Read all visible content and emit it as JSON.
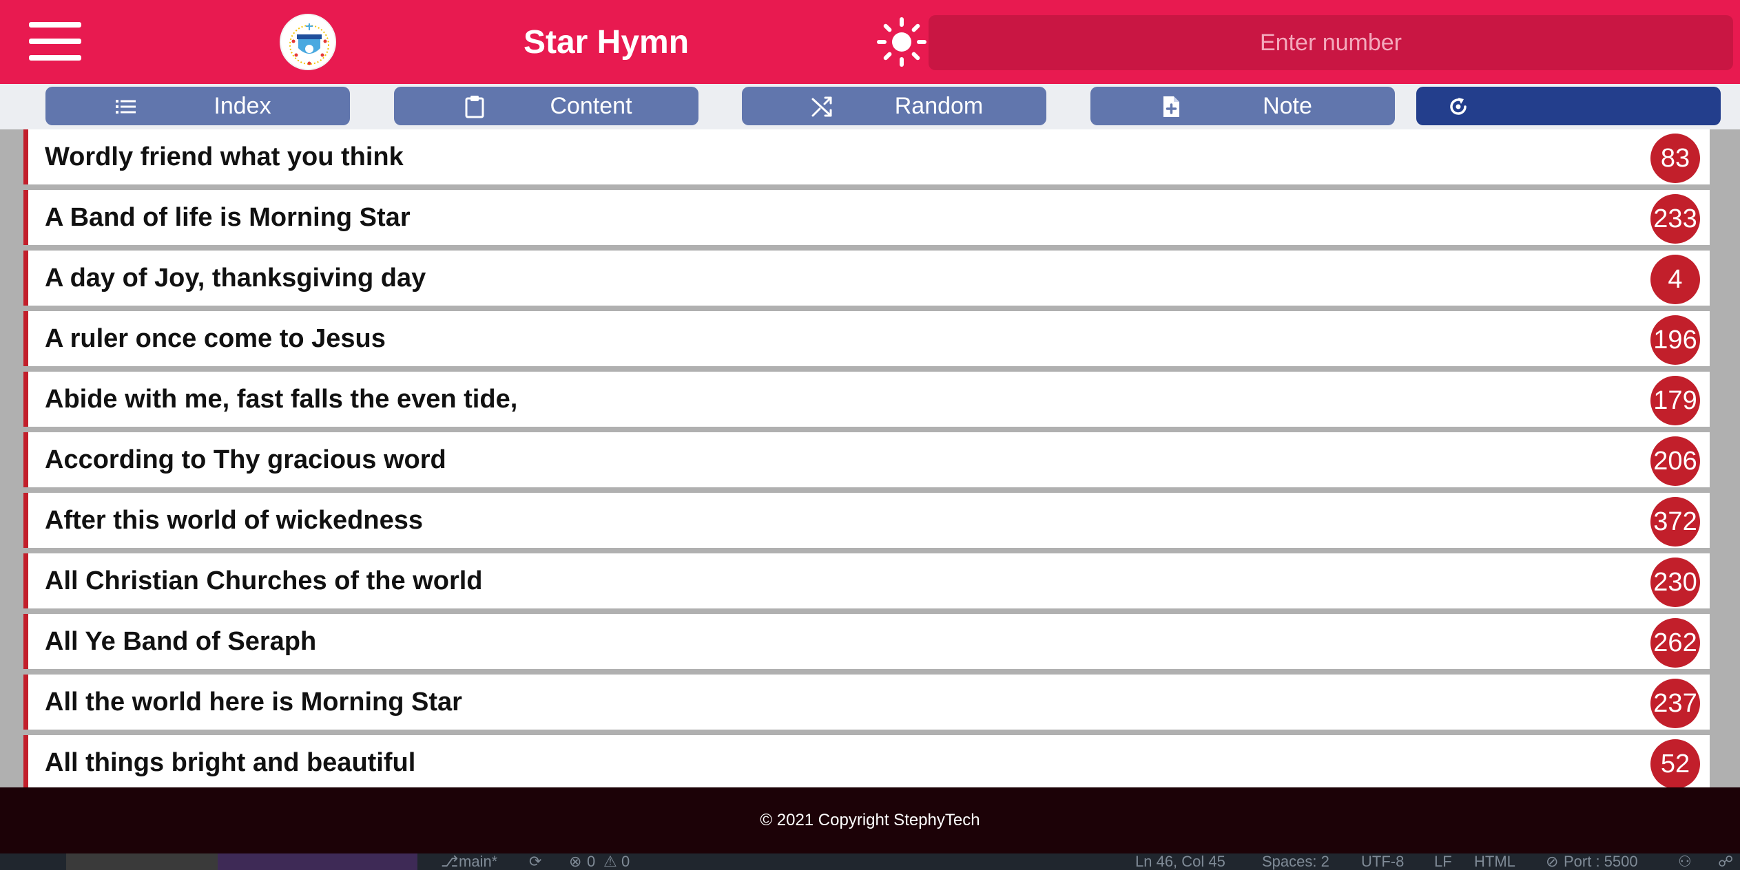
{
  "header": {
    "title": "Star Hymn",
    "logo_text": "STAR OF LIFE",
    "search_placeholder": "Enter number",
    "menu_icon": "hamburger-menu-icon",
    "theme_icon": "sun-icon"
  },
  "toolbar": {
    "buttons": [
      {
        "label": "Index",
        "icon": "list-icon"
      },
      {
        "label": "Content",
        "icon": "clipboard-icon"
      },
      {
        "label": "Random",
        "icon": "shuffle-icon"
      },
      {
        "label": "Note",
        "icon": "add-file-icon"
      },
      {
        "label": "",
        "icon": "refresh-icon"
      }
    ]
  },
  "hymns": [
    {
      "title": "Wordly friend what you think",
      "number": "83"
    },
    {
      "title": "A Band of life is Morning Star",
      "number": "233"
    },
    {
      "title": "A day of Joy, thanksgiving day",
      "number": "4"
    },
    {
      "title": "A ruler once come to Jesus",
      "number": "196"
    },
    {
      "title": "Abide with me, fast falls the even tide,",
      "number": "179"
    },
    {
      "title": "According to Thy gracious word",
      "number": "206"
    },
    {
      "title": "After this world of wickedness",
      "number": "372"
    },
    {
      "title": "All Christian Churches of the world",
      "number": "230"
    },
    {
      "title": "All Ye Band of Seraph",
      "number": "262"
    },
    {
      "title": "All the world here is Morning Star",
      "number": "237"
    },
    {
      "title": "All things bright and beautiful",
      "number": "52"
    }
  ],
  "footer": {
    "copyright": "© 2021 Copyright StephyTech"
  },
  "editor_status": {
    "branch": "main*",
    "errors": "0",
    "warnings": "0",
    "position": "Ln 46, Col 45",
    "spaces": "Spaces: 2",
    "encoding": "UTF-8",
    "eol": "LF",
    "language": "HTML",
    "port": "Port : 5500"
  },
  "colors": {
    "header_bg": "#e81a50",
    "search_bg": "#c91643",
    "button_bg": "#6176ad",
    "button_active_bg": "#233e8c",
    "accent_red": "#c21f2b",
    "footer_bg": "#1c0207"
  }
}
